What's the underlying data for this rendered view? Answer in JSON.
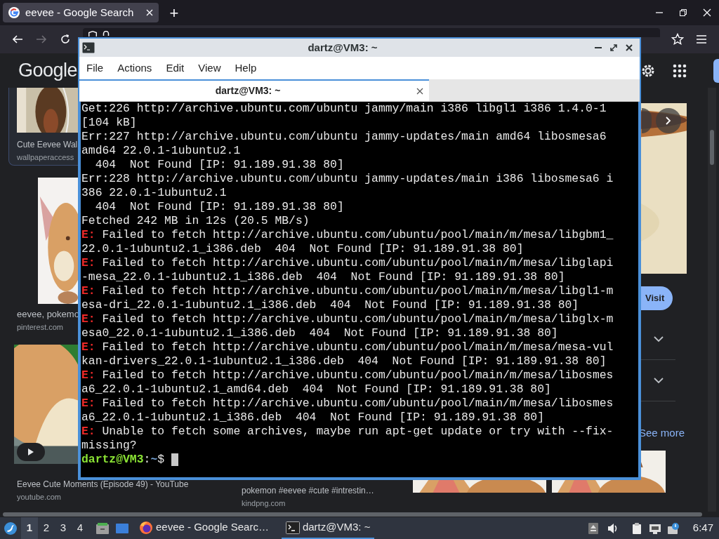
{
  "browser": {
    "tabs": [
      {
        "title": "eevee - Google Search",
        "selected": true
      }
    ],
    "new_tab": "+",
    "back": {
      "disabled": false
    },
    "forward": {
      "disabled": true
    }
  },
  "google": {
    "logo": "Google",
    "results": [
      {
        "kind": "card",
        "title": "Cute Eevee Wal",
        "source": "wallpaperaccess"
      },
      {
        "title": "eevee, pokemo",
        "source": "pinterest.com"
      },
      {
        "kind": "video",
        "title": "Eevee Cute Moments (Episode 49) - YouTube",
        "source": "youtube.com"
      }
    ],
    "second_column": [
      {
        "title": "pokemon #eevee #cute #intrestin…",
        "source": "kindpng.com"
      }
    ],
    "preview": {
      "visit": "Visit",
      "sections": [
        {
          "expanded": false
        },
        {
          "expanded": false
        }
      ],
      "see_more": "See more"
    }
  },
  "terminal": {
    "title": "dartz@VM3: ~",
    "menu": [
      "File",
      "Actions",
      "Edit",
      "View",
      "Help"
    ],
    "tabs": [
      {
        "title": "dartz@VM3: ~",
        "selected": true
      }
    ],
    "lines": [
      {
        "text": "Get:226 http://archive.ubuntu.com/ubuntu jammy/main i386 libgl1 i386 1.4.0-1"
      },
      {
        "text": "[104 kB]"
      },
      {
        "text": "Err:227 http://archive.ubuntu.com/ubuntu jammy-updates/main amd64 libosmesa6"
      },
      {
        "text": "amd64 22.0.1-1ubuntu2.1"
      },
      {
        "text": "  404  Not Found [IP: 91.189.91.38 80]"
      },
      {
        "text": "Err:228 http://archive.ubuntu.com/ubuntu jammy-updates/main i386 libosmesa6 i"
      },
      {
        "text": "386 22.0.1-1ubuntu2.1"
      },
      {
        "text": "  404  Not Found [IP: 91.189.91.38 80]"
      },
      {
        "text": "Fetched 242 MB in 12s (20.5 MB/s)"
      },
      {
        "prefix": "E:",
        "text": " Failed to fetch http://archive.ubuntu.com/ubuntu/pool/main/m/mesa/libgbm1_"
      },
      {
        "text": "22.0.1-1ubuntu2.1_i386.deb  404  Not Found [IP: 91.189.91.38 80]"
      },
      {
        "prefix": "E:",
        "text": " Failed to fetch http://archive.ubuntu.com/ubuntu/pool/main/m/mesa/libglapi"
      },
      {
        "text": "-mesa_22.0.1-1ubuntu2.1_i386.deb  404  Not Found [IP: 91.189.91.38 80]"
      },
      {
        "prefix": "E:",
        "text": " Failed to fetch http://archive.ubuntu.com/ubuntu/pool/main/m/mesa/libgl1-m"
      },
      {
        "text": "esa-dri_22.0.1-1ubuntu2.1_i386.deb  404  Not Found [IP: 91.189.91.38 80]"
      },
      {
        "prefix": "E:",
        "text": " Failed to fetch http://archive.ubuntu.com/ubuntu/pool/main/m/mesa/libglx-m"
      },
      {
        "text": "esa0_22.0.1-1ubuntu2.1_i386.deb  404  Not Found [IP: 91.189.91.38 80]"
      },
      {
        "prefix": "E:",
        "text": " Failed to fetch http://archive.ubuntu.com/ubuntu/pool/main/m/mesa/mesa-vul"
      },
      {
        "text": "kan-drivers_22.0.1-1ubuntu2.1_i386.deb  404  Not Found [IP: 91.189.91.38 80]"
      },
      {
        "prefix": "E:",
        "text": " Failed to fetch http://archive.ubuntu.com/ubuntu/pool/main/m/mesa/libosmes"
      },
      {
        "text": "a6_22.0.1-1ubuntu2.1_amd64.deb  404  Not Found [IP: 91.189.91.38 80]"
      },
      {
        "prefix": "E:",
        "text": " Failed to fetch http://archive.ubuntu.com/ubuntu/pool/main/m/mesa/libosmes"
      },
      {
        "text": "a6_22.0.1-1ubuntu2.1_i386.deb  404  Not Found [IP: 91.189.91.38 80]"
      },
      {
        "prefix": "E:",
        "text": " Unable to fetch some archives, maybe run apt-get update or try with --fix-"
      },
      {
        "text": "missing?"
      }
    ],
    "prompt": {
      "user": "dartz@VM3",
      "separator": ":",
      "path": "~",
      "symbol": "$"
    }
  },
  "taskbar": {
    "workspaces": [
      {
        "label": "1",
        "selected": true
      },
      {
        "label": "2",
        "selected": false
      },
      {
        "label": "3",
        "selected": false
      },
      {
        "label": "4",
        "selected": false
      }
    ],
    "windows": [
      {
        "kind": "browser",
        "title": "eevee - Google Searc…",
        "selected": false
      },
      {
        "kind": "terminal",
        "title": "dartz@VM3: ~",
        "selected": true
      }
    ],
    "clock": "6:47"
  }
}
